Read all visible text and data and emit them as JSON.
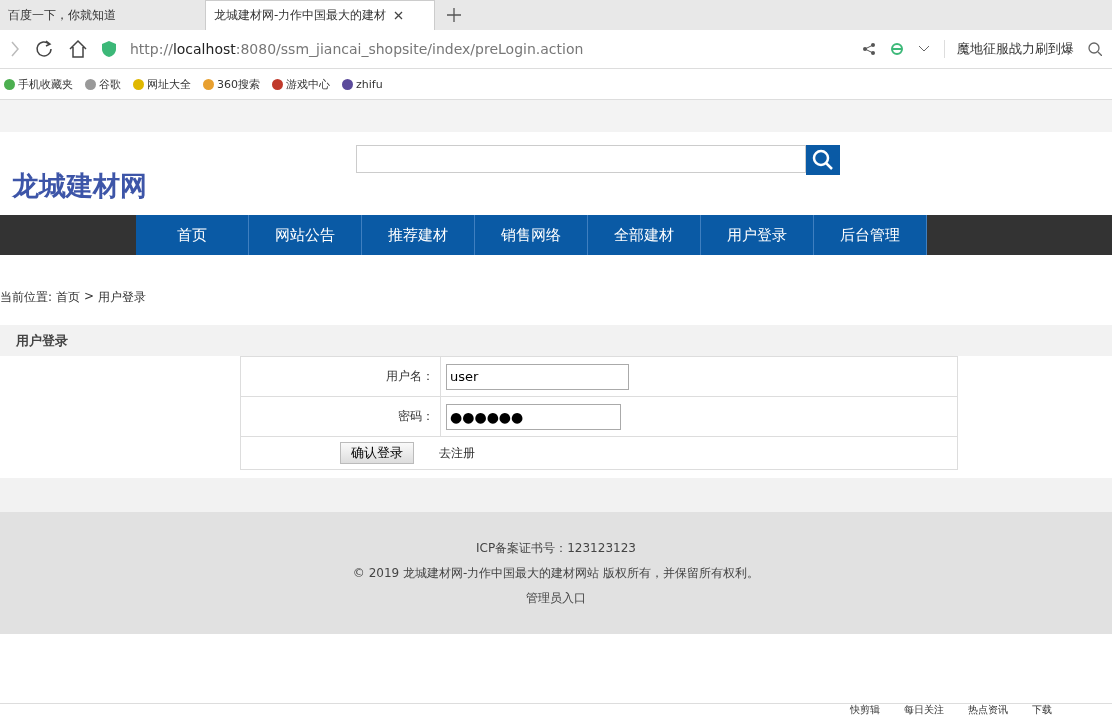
{
  "browser": {
    "tabs": [
      {
        "label": "百度一下，你就知道",
        "selected": false
      },
      {
        "label": "龙城建材网-力作中国最大的建材",
        "selected": true
      }
    ],
    "address": {
      "scheme": "http://",
      "host": "localhost",
      "rest": ":8080/ssm_jiancai_shopsite/index/preLogin.action"
    },
    "search_hint": "魔地征服战力刷到爆",
    "bookmarks": [
      "手机收藏夹",
      "谷歌",
      "网址大全",
      "360搜索",
      "游戏中心",
      "zhifu"
    ],
    "status_items": [
      "快剪辑",
      "每日关注",
      "热点资讯",
      "下载"
    ]
  },
  "site": {
    "logo": "龙城建材网",
    "nav": [
      {
        "label": "首页",
        "selected": false
      },
      {
        "label": "网站公告",
        "selected": false
      },
      {
        "label": "推荐建材",
        "selected": false
      },
      {
        "label": "销售网络",
        "selected": false
      },
      {
        "label": "全部建材",
        "selected": false
      },
      {
        "label": "用户登录",
        "selected": false
      },
      {
        "label": "后台管理",
        "selected": false
      }
    ],
    "breadcrumb": {
      "prefix": "当前位置:",
      "items": [
        "首页",
        "用户登录"
      ],
      "separator": ">"
    },
    "section_title": "用户登录",
    "form": {
      "fields": [
        {
          "label": "用户名：",
          "value": "user",
          "kind": "text"
        },
        {
          "label": "密码：",
          "value": "●●●●●●",
          "kind": "password"
        }
      ],
      "submit": "确认登录",
      "register_link": "去注册"
    },
    "footer": [
      "ICP备案证书号：123123123",
      "© 2019 龙城建材网-力作中国最大的建材网站 版权所有，并保留所有权利。",
      "管理员入口"
    ]
  }
}
